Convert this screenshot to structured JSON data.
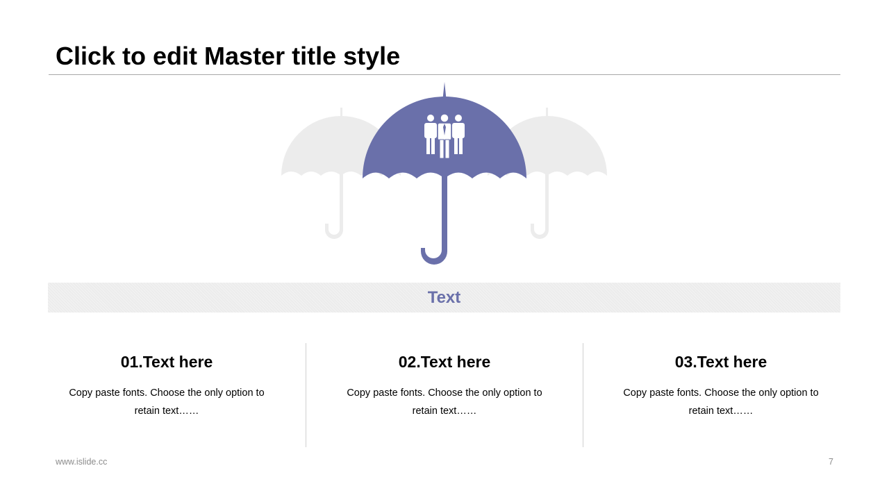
{
  "slide": {
    "title": "Click to edit Master title style",
    "banner_text": "Text",
    "columns": [
      {
        "heading": "01.Text here",
        "body": "Copy paste fonts. Choose the only option to retain text……"
      },
      {
        "heading": "02.Text here",
        "body": "Copy paste fonts. Choose the only option to retain text……"
      },
      {
        "heading": "03.Text here",
        "body": "Copy paste fonts. Choose the only option to retain text……"
      }
    ]
  },
  "footer": {
    "url": "www.islide.cc",
    "page_number": "7"
  },
  "icons": {
    "main": "umbrella-icon",
    "people": "people-group-icon",
    "side": "umbrella-icon"
  },
  "colors": {
    "accent": "#6a70aa",
    "ghost": "#ececec",
    "text": "#000000",
    "muted": "#8c8c8c"
  }
}
